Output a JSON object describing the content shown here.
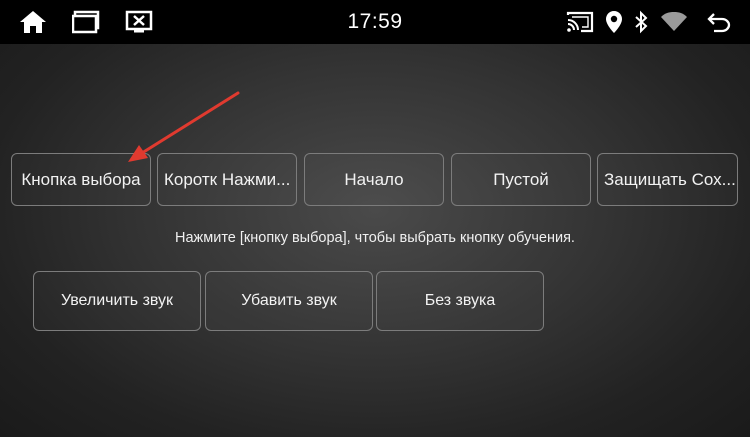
{
  "status_bar": {
    "time": "17:59",
    "icons": {
      "home": "home-icon",
      "recent_apps": "recent-apps-icon",
      "screen_off": "screen-off-icon",
      "cast": "cast-icon",
      "location": "location-icon",
      "bluetooth": "bluetooth-icon",
      "wifi": "wifi-icon",
      "back": "back-icon"
    }
  },
  "key_slots": [
    {
      "label": "Кнопка выбора"
    },
    {
      "label": "Коротк Нажми..."
    },
    {
      "label": "Начало"
    },
    {
      "label": "Пустой"
    },
    {
      "label": "Защищать Сох..."
    }
  ],
  "hint_text": "Нажмите [кнопку выбора], чтобы выбрать кнопку обучения.",
  "actions": [
    {
      "label": "Увеличить звук"
    },
    {
      "label": "Убавить звук"
    },
    {
      "label": "Без звука"
    }
  ],
  "annotation": {
    "type": "arrow",
    "color": "#e03a2f"
  }
}
